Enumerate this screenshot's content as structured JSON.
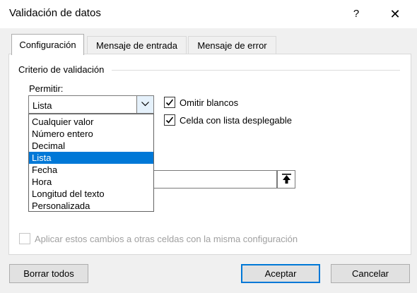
{
  "window": {
    "title": "Validación de datos",
    "help_label": "?",
    "close_label": "✕"
  },
  "tabs": [
    {
      "label": "Configuración",
      "active": true
    },
    {
      "label": "Mensaje de entrada",
      "active": false
    },
    {
      "label": "Mensaje de error",
      "active": false
    }
  ],
  "criteria": {
    "group_label": "Criterio de validación",
    "allow_label": "Permitir:",
    "allow_selected": "Lista",
    "allow_options": [
      "Cualquier valor",
      "Número entero",
      "Decimal",
      "Lista",
      "Fecha",
      "Hora",
      "Longitud del texto",
      "Personalizada"
    ],
    "ignore_blank_label": "Omitir blancos",
    "ignore_blank_checked": true,
    "dropdown_label": "Celda con lista desplegable",
    "dropdown_checked": true,
    "source_value": ""
  },
  "apply": {
    "label": "Aplicar estos cambios a otras celdas con la misma configuración",
    "checked": false,
    "enabled": false
  },
  "buttons": {
    "clear_all": "Borrar todos",
    "accept": "Aceptar",
    "cancel": "Cancelar"
  },
  "colors": {
    "accent": "#0078d7",
    "background": "#f0f0f0",
    "panel": "#ffffff",
    "disabled_text": "#a0a0a0"
  }
}
